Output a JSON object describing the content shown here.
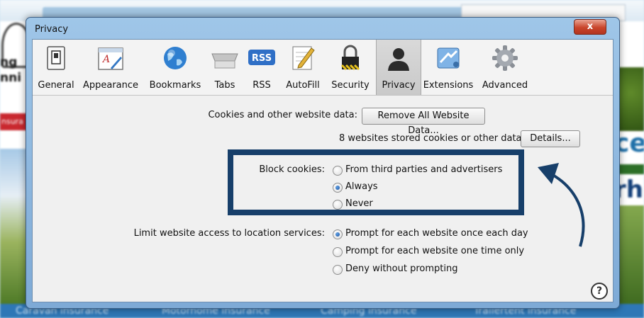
{
  "window": {
    "title": "Privacy",
    "close_glyph": "x"
  },
  "toolbar": {
    "items": [
      {
        "label": "General",
        "icon": "general-switch-icon"
      },
      {
        "label": "Appearance",
        "icon": "appearance-font-icon"
      },
      {
        "label": "Bookmarks",
        "icon": "bookmarks-globe-icon"
      },
      {
        "label": "Tabs",
        "icon": "tabs-icon"
      },
      {
        "label": "RSS",
        "icon": "rss-icon",
        "icon_text": "RSS"
      },
      {
        "label": "AutoFill",
        "icon": "autofill-pencil-icon"
      },
      {
        "label": "Security",
        "icon": "security-lock-icon"
      },
      {
        "label": "Privacy",
        "icon": "privacy-person-icon",
        "selected": true
      },
      {
        "label": "Extensions",
        "icon": "extensions-puzzle-icon"
      },
      {
        "label": "Advanced",
        "icon": "advanced-gear-icon"
      }
    ]
  },
  "cookies": {
    "label": "Cookies and other website data:",
    "remove_button": "Remove All Website Data...",
    "stored_text": "8 websites stored cookies or other data",
    "details_button": "Details..."
  },
  "block_cookies": {
    "label": "Block cookies:",
    "options": [
      {
        "label": "From third parties and advertisers",
        "selected": false
      },
      {
        "label": "Always",
        "selected": true
      },
      {
        "label": "Never",
        "selected": false
      }
    ]
  },
  "location": {
    "label": "Limit website access to location services:",
    "options": [
      {
        "label": "Prompt for each website once each day",
        "selected": true
      },
      {
        "label": "Prompt for each website one time only",
        "selected": false
      },
      {
        "label": "Deny without prompting",
        "selected": false
      }
    ]
  },
  "help_glyph": "?",
  "background": {
    "left_text_1": "ng",
    "left_text_2": "nni",
    "left_red_text": "nsura",
    "right_text_1": "ce",
    "right_text_2": "rh",
    "bottom_links": [
      "Caravan insurance",
      "Motorhome insurance",
      "Camping insurance",
      "Trailertent insurance"
    ]
  },
  "colors": {
    "highlight_border": "#173f6a",
    "arrow": "#173f6a",
    "window_frame": "#9fc6e8"
  }
}
